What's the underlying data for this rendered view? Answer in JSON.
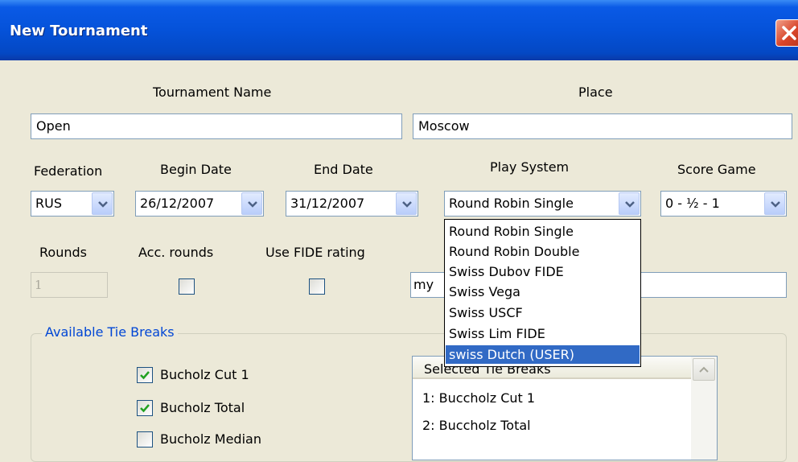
{
  "window": {
    "title": "New Tournament"
  },
  "labels": {
    "tournament_name": "Tournament Name",
    "place": "Place",
    "federation": "Federation",
    "begin_date": "Begin Date",
    "end_date": "End Date",
    "play_system": "Play System",
    "score_game": "Score Game",
    "rounds": "Rounds",
    "acc_rounds": "Acc. rounds",
    "use_fide_rating": "Use FIDE rating"
  },
  "fields": {
    "tournament_name": "Open",
    "place": "Moscow",
    "rounds": "1",
    "partial_text": "my"
  },
  "combos": {
    "federation": "RUS",
    "begin_date": "26/12/2007",
    "end_date": "31/12/2007",
    "play_system": "Round Robin Single",
    "score_game": "0 - ½ - 1"
  },
  "checkboxes": {
    "acc_rounds": false,
    "use_fide_rating": false
  },
  "play_system_options": [
    "Round Robin Single",
    "Round Robin Double",
    "Swiss Dubov FIDE",
    "Swiss Vega",
    "Swiss USCF",
    "Swiss Lim FIDE",
    "swiss Dutch (USER)"
  ],
  "play_system_highlighted": "swiss Dutch (USER)",
  "tie_breaks": {
    "group_title": "Available Tie Breaks",
    "available": [
      {
        "label": "Bucholz Cut 1",
        "checked": true
      },
      {
        "label": "Bucholz Total",
        "checked": true
      },
      {
        "label": "Bucholz Median",
        "checked": false
      }
    ],
    "selected_header": "Selected Tie Breaks",
    "selected": [
      "1: Buccholz Cut 1",
      "2: Buccholz Total"
    ]
  },
  "colors": {
    "titlebar": "#0552d9",
    "dialog_bg": "#ece9d8",
    "selection": "#316ac5",
    "group_title": "#0046d5",
    "checkmark": "#21a121"
  }
}
